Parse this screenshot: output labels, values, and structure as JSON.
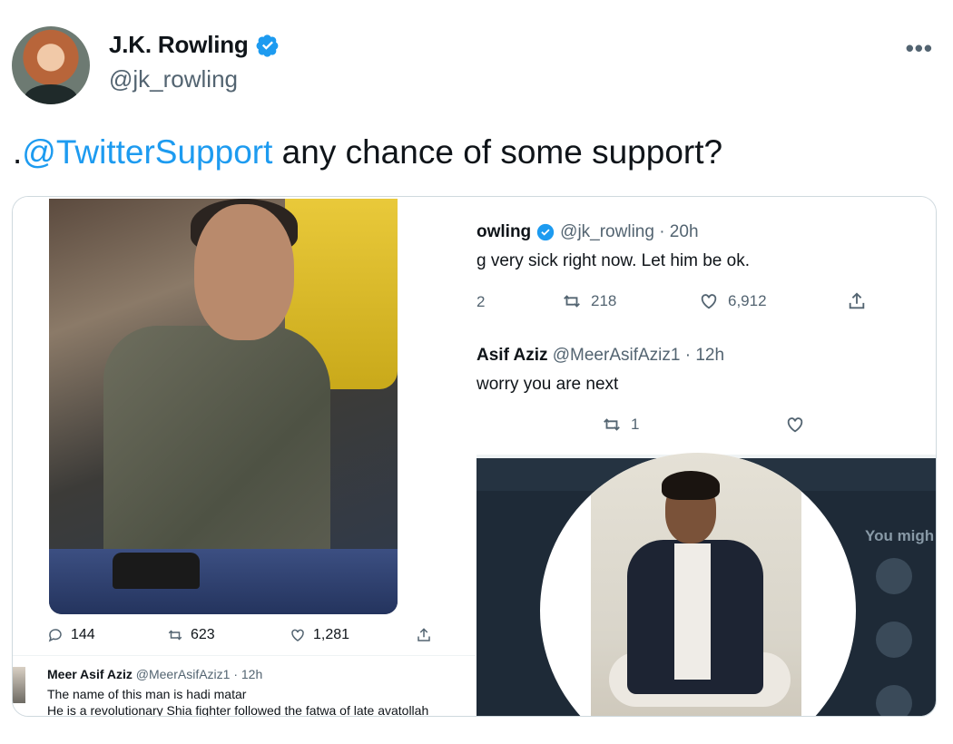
{
  "tweet": {
    "author_name": "J.K. Rowling",
    "handle": "@jk_rowling",
    "more_label": "•••",
    "text_prefix": ".",
    "mention": "@TwitterSupport",
    "text_rest": " any chance of some support?"
  },
  "left_screenshot": {
    "stats": {
      "replies": "144",
      "retweets": "623",
      "likes": "1,281"
    },
    "reply_author_name": "Meer Asif Aziz",
    "reply_author_handle": "@MeerAsifAziz1 · 12h",
    "reply_line1": "The name of this man is hadi matar",
    "reply_line2": "He is a revolutionary Shia fighter followed the fatwa of late avatollah"
  },
  "right_screenshot": {
    "tweet1_name": "owling",
    "tweet1_handle": "@jk_rowling · 20h",
    "tweet1_text": "g very sick right now. Let him be ok.",
    "tweet1_replies": "2",
    "tweet1_retweets": "218",
    "tweet1_likes": "6,912",
    "tweet2_name": "Asif Aziz",
    "tweet2_handle": "@MeerAsifAziz1 · 12h",
    "tweet2_text": "worry you are next",
    "tweet2_retweets": "1",
    "sidebar_title": "You migh"
  },
  "colors": {
    "link": "#1d9bf0",
    "muted": "#536471",
    "text": "#0f1419"
  }
}
